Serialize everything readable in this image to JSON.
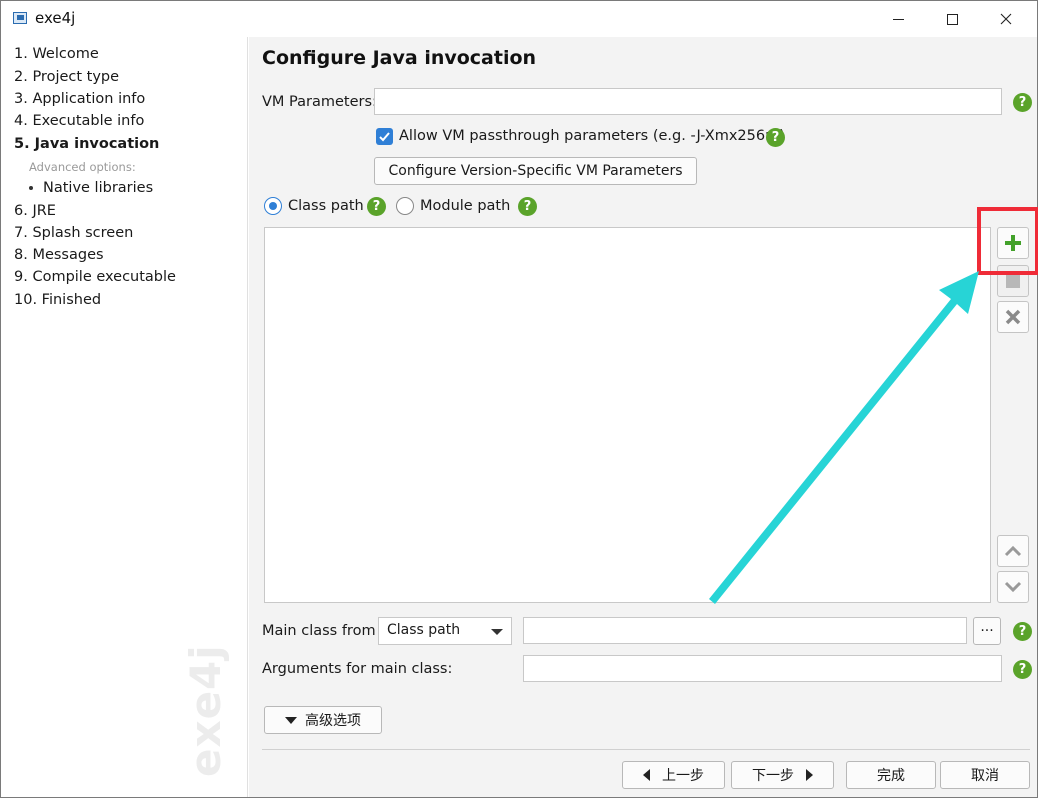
{
  "window": {
    "title": "exe4j"
  },
  "sidebar": {
    "steps": [
      {
        "label": "1. Welcome"
      },
      {
        "label": "2. Project type"
      },
      {
        "label": "3. Application info"
      },
      {
        "label": "4. Executable info"
      },
      {
        "label": "5. Java invocation"
      },
      {
        "label": "Advanced options:"
      },
      {
        "label": "Native libraries"
      },
      {
        "label": "6. JRE"
      },
      {
        "label": "7. Splash screen"
      },
      {
        "label": "8. Messages"
      },
      {
        "label": "9. Compile executable"
      },
      {
        "label": "10. Finished"
      }
    ],
    "active_step": "5. Java invocation",
    "watermark": "exe4j"
  },
  "main": {
    "title": "Configure Java invocation",
    "vm_parameters": {
      "label": "VM Parameters:",
      "value": ""
    },
    "allow_passthrough": {
      "label": "Allow VM passthrough parameters (e.g. -J-Xmx256m)",
      "checked": true
    },
    "configure_version_button": "Configure Version-Specific VM Parameters",
    "path_mode": {
      "class_path_label": "Class path",
      "module_path_label": "Module path",
      "selected": "Class path"
    },
    "main_class": {
      "label": "Main class from",
      "source": "Class path",
      "value": "",
      "browse_label": "···"
    },
    "arguments": {
      "label": "Arguments for main class:",
      "value": ""
    },
    "advanced_button": "高级选项"
  },
  "footer": {
    "back": "上一步",
    "next": "下一步",
    "finish": "完成",
    "cancel": "取消"
  },
  "help_glyph": "?",
  "colors": {
    "accent": "#2f7fd6",
    "help_green": "#5aa32a",
    "highlight_red": "#ef2b37",
    "annotation_arrow": "#27d4d6"
  }
}
